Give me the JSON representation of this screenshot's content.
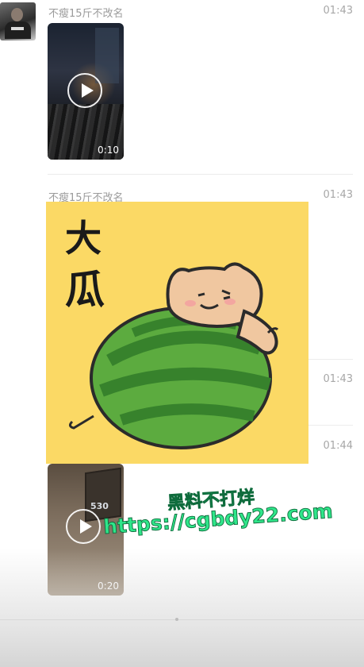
{
  "messages": [
    {
      "sender": "不瘦15斤不改名",
      "time": "01:43",
      "type": "video",
      "duration": "0:10"
    },
    {
      "sender": "不瘦15斤不改名",
      "time": "01:43",
      "type": "sticker",
      "sticker_text": "大瓜"
    },
    {
      "time": "01:43"
    },
    {
      "time": "01:44",
      "type": "video",
      "duration": "0:20",
      "room_number": "530"
    }
  ],
  "watermark": {
    "line1": "黑料不打烊",
    "line2": "https://cgbdy22.com",
    "color": "#2fe68a"
  },
  "icons": {
    "play": "play-icon",
    "avatar": "user-avatar"
  }
}
